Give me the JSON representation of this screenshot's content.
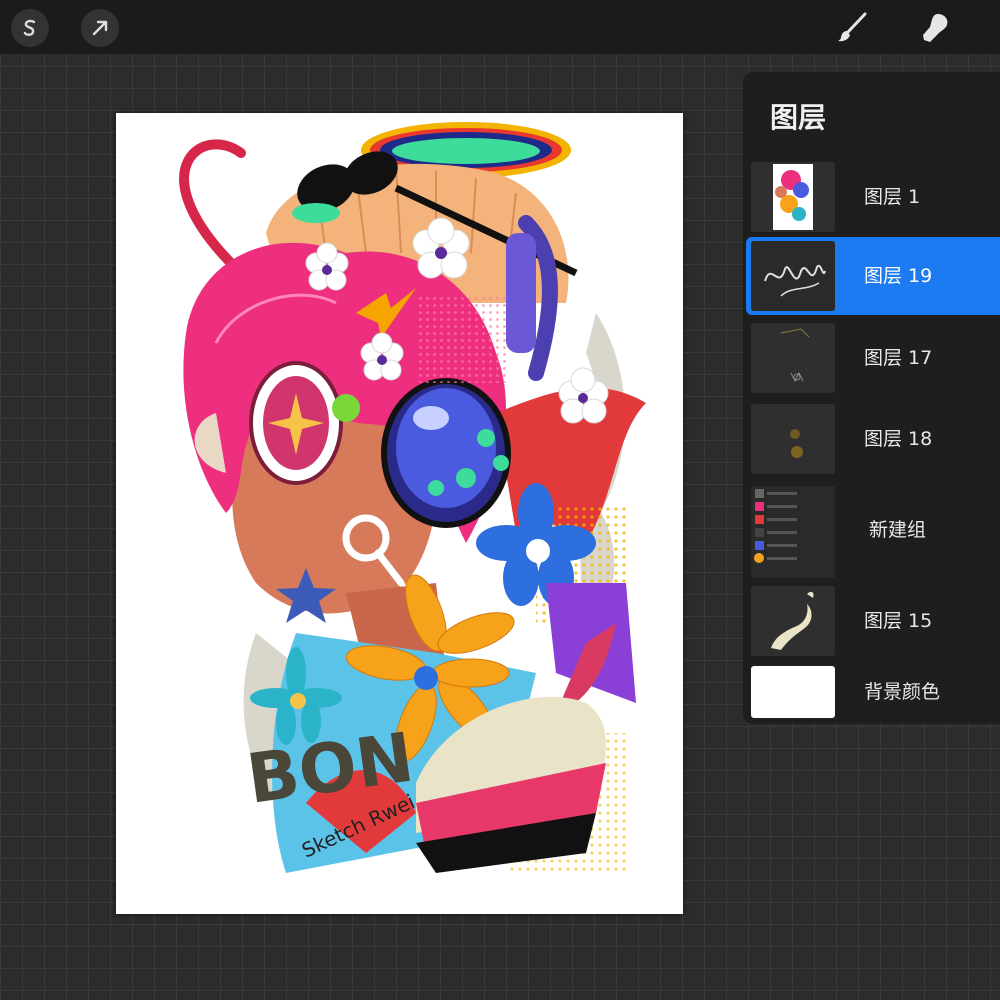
{
  "toolbar": {
    "left_tools": [
      "selection-s-icon",
      "transform-arrow-icon"
    ],
    "right_tools": [
      "brush-icon",
      "smudge-icon"
    ]
  },
  "layers_panel": {
    "title": "图层",
    "layers": [
      {
        "name": "图层 1",
        "active": false
      },
      {
        "name": "图层 19",
        "active": true
      },
      {
        "name": "图层 17",
        "active": false
      },
      {
        "name": "图层 18",
        "active": false
      },
      {
        "name": "新建组",
        "active": false
      },
      {
        "name": "图层 15",
        "active": false
      },
      {
        "name": "背景颜色",
        "active": false
      }
    ]
  },
  "artwork": {
    "text": "BON",
    "signature": "Sketch Rwei"
  },
  "colors": {
    "accent": "#1c7bf0",
    "panel": "#1e1e1e",
    "toolbar": "#1b1b1b"
  }
}
